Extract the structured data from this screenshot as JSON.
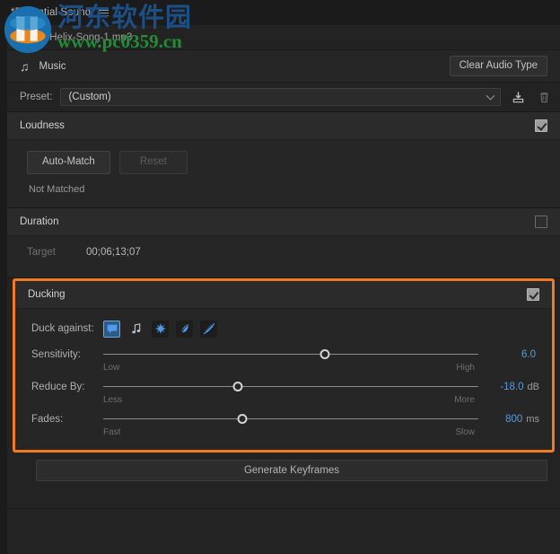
{
  "panel": {
    "tab_label": "*Essential Sound",
    "menu_icon": "hamburger-menu-icon",
    "filename": "SoundHelix-Song-1.mp3"
  },
  "audio_type": {
    "icon": "music-note-icon",
    "name": "Music",
    "clear_button": "Clear Audio Type"
  },
  "preset": {
    "label": "Preset:",
    "value": "(Custom)",
    "placeholder": "(Custom)",
    "chevron_icon": "chevron-down-icon",
    "save_icon": "save-preset-icon",
    "delete_icon": "delete-preset-icon"
  },
  "loudness": {
    "title": "Loudness",
    "enabled": true,
    "auto_match_button": "Auto-Match",
    "reset_button": "Reset",
    "reset_disabled": true,
    "status": "Not Matched"
  },
  "duration": {
    "title": "Duration",
    "enabled": false,
    "target_label": "Target",
    "target_value": "00;06;13;07"
  },
  "ducking": {
    "title": "Ducking",
    "enabled": true,
    "highlighted": true,
    "highlight_color": "#f07b20",
    "duck_against_label": "Duck against:",
    "duck_targets": [
      {
        "name": "dialogue-icon",
        "selected": true
      },
      {
        "name": "music-note-icon",
        "selected": false
      },
      {
        "name": "sfx-icon",
        "selected": false
      },
      {
        "name": "ambience-icon",
        "selected": false
      },
      {
        "name": "no-audio-type-icon",
        "selected": false
      }
    ],
    "sliders": [
      {
        "label": "Sensitivity:",
        "value": "6.0",
        "unit": "",
        "min_label": "Low",
        "max_label": "High",
        "percent": 59
      },
      {
        "label": "Reduce By:",
        "value": "-18.0",
        "unit": "dB",
        "min_label": "Less",
        "max_label": "More",
        "percent": 36
      },
      {
        "label": "Fades:",
        "value": "800",
        "unit": "ms",
        "min_label": "Fast",
        "max_label": "Slow",
        "percent": 37
      }
    ]
  },
  "keyframes": {
    "button": "Generate Keyframes"
  },
  "watermark": {
    "site_name": "河东软件园",
    "url": "www.pc0359.cn",
    "logo": "site-logo-icon"
  },
  "colors": {
    "accent_blue": "#5b9bd5",
    "highlight_orange": "#f07b20",
    "panel_bg": "#262626",
    "window_bg": "#1b1b1b"
  }
}
